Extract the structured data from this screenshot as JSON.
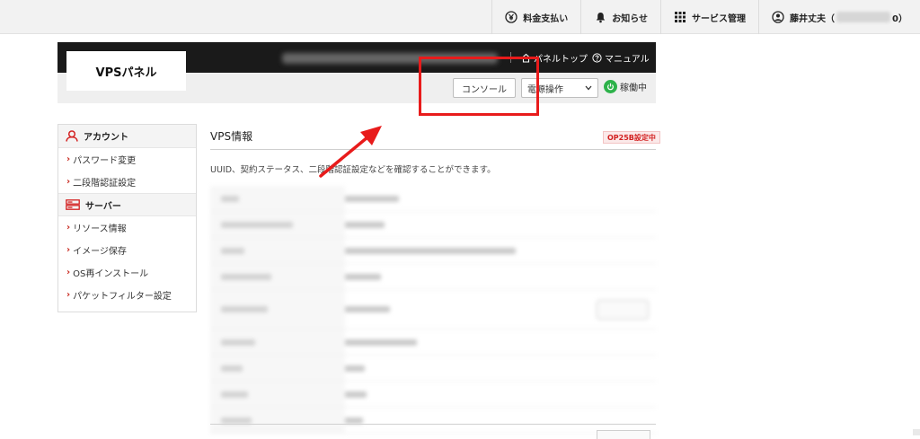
{
  "topbar": {
    "items": [
      {
        "label": "料金支払い",
        "icon": "yen-circle-icon"
      },
      {
        "label": "お知らせ",
        "icon": "bell-icon"
      },
      {
        "label": "サービス管理",
        "icon": "grid-icon"
      },
      {
        "label_prefix": "藤井丈夫（",
        "label_suffix": "0）",
        "icon": "user-circle-icon"
      }
    ]
  },
  "header": {
    "logo": "VPSパネル",
    "links": {
      "panel_top": "パネルトップ",
      "manual": "マニュアル"
    },
    "console_button": "コンソール",
    "power_select": "電源操作",
    "status": "稼働中"
  },
  "sidebar": {
    "sections": [
      {
        "title": "アカウント",
        "icon": "account-icon",
        "items": [
          "パスワード変更",
          "二段階認証設定"
        ]
      },
      {
        "title": "サーバー",
        "icon": "server-icon",
        "items": [
          "リソース情報",
          "イメージ保存",
          "OS再インストール",
          "パケットフィルター設定"
        ]
      }
    ]
  },
  "main": {
    "title": "VPS情報",
    "badge": "OP25B設定中",
    "description": "UUID、契約ステータス、二段階認証設定などを確認することができます。"
  },
  "colors": {
    "accent_red": "#e81b1b",
    "status_green": "#2db24a",
    "header_dark": "#1a1a1a"
  }
}
